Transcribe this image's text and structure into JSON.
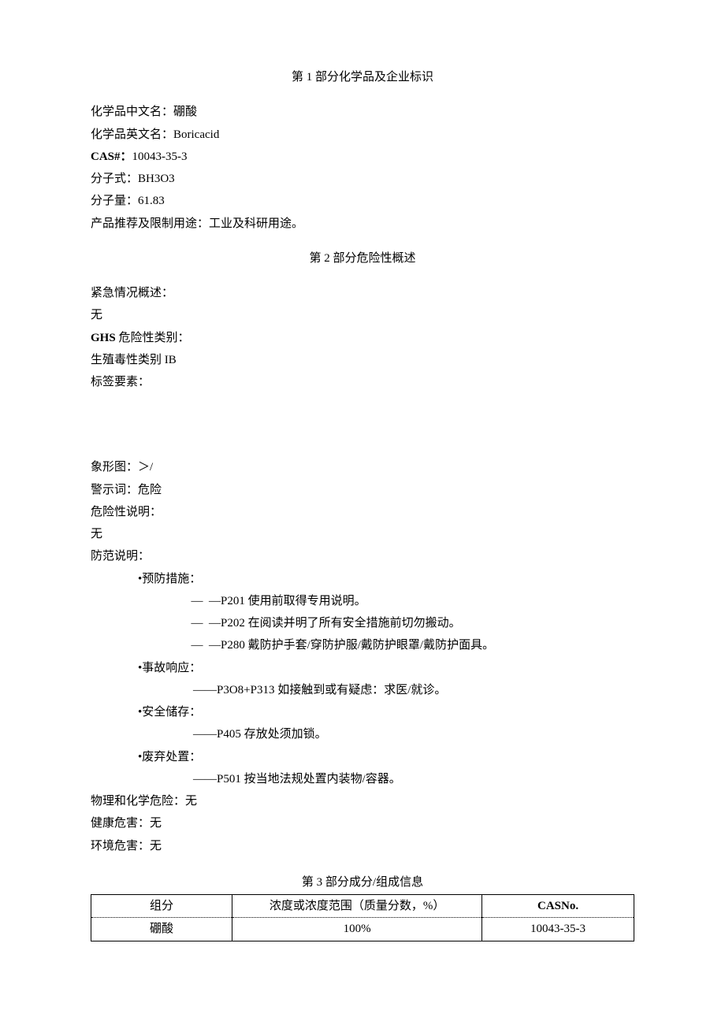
{
  "section1": {
    "title": "第 1 部分化学品及企业标识",
    "lines": {
      "cn_name_label": "化学品中文名：",
      "cn_name_value": "硼酸",
      "en_name_label": "化学品英文名：",
      "en_name_value": "Boricacid",
      "cas_label": "CAS#：",
      "cas_value": "10043-35-3",
      "formula_label": "分子式：",
      "formula_value": "BH3O3",
      "mw_label": "分子量：",
      "mw_value": "61.83",
      "usage_label": "产品推荐及限制用途：",
      "usage_value": "工业及科研用途。"
    }
  },
  "section2": {
    "title": "第 2 部分危险性概述",
    "emergency_label": "紧急情况概述：",
    "emergency_value": "无",
    "ghs_label": "GHS 危险性类别：",
    "ghs_value": "生殖毒性类别 IB",
    "label_elements": "标签要素：",
    "pictogram_label": "象形图：",
    "pictogram_value": "＞/",
    "signal_label": "警示词：",
    "signal_value": "危险",
    "hazard_label": "危险性说明：",
    "hazard_value": "无",
    "precaution_label": "防范说明：",
    "prevention": {
      "heading": "•预防措施：",
      "dash": "—",
      "items": [
        "—P201 使用前取得专用说明。",
        "—P202 在阅读并明了所有安全措施前切勿搬动。",
        "—P280 戴防护手套/穿防护服/戴防护眼罩/戴防护面具。"
      ]
    },
    "response": {
      "heading": "•事故响应：",
      "item": "——P3O8+P313 如接触到或有疑虑：求医/就诊。"
    },
    "storage": {
      "heading": "•安全储存：",
      "item": "——P405 存放处须加锁。"
    },
    "disposal": {
      "heading": "•废弃处置：",
      "item": "——P501 按当地法规处置内装物/容器。"
    },
    "physchem_label": "物理和化学危险：",
    "physchem_value": "无",
    "health_label": "健康危害：",
    "health_value": "无",
    "env_label": "环境危害：",
    "env_value": "无"
  },
  "section3": {
    "title": "第 3 部分成分/组成信息",
    "headers": {
      "component": "组分",
      "concentration": "浓度或浓度范围（质量分数，%）",
      "casno": "CASNo."
    },
    "rows": [
      {
        "component": "硼酸",
        "concentration": "100%",
        "casno": "10043-35-3"
      }
    ]
  }
}
